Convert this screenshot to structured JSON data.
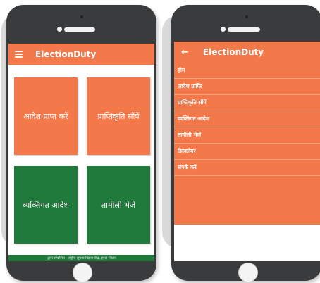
{
  "left_phone": {
    "app_title": "ElectionDuty",
    "tiles": [
      {
        "label": "आदेश प्राप्त करें",
        "color": "#f3784a"
      },
      {
        "label": "प्राप्तिकृति सौंपें",
        "color": "#f3784a"
      },
      {
        "label": "व्यक्तिगत आदेश",
        "color": "#1f7a3c"
      },
      {
        "label": "तामीली भेजें",
        "color": "#1f7a3c"
      }
    ],
    "footer_text": "द्वारा संचालित - राष्ट्रीय सूचना विज्ञान केंद्र, हरदा जिला"
  },
  "right_phone": {
    "app_title": "ElectionDuty",
    "menu_items": [
      {
        "label": "होम"
      },
      {
        "label": "आदेश प्राप्ति"
      },
      {
        "label": "प्राप्तिकृति सौंपें"
      },
      {
        "label": "व्यक्तिगत आदेश"
      },
      {
        "label": "तामीली भेजें"
      },
      {
        "label": "डिस्क्लेमर"
      },
      {
        "label": "संपर्क करें"
      }
    ]
  },
  "colors": {
    "accent_orange": "#f3784a",
    "accent_green": "#1f7a3c",
    "phone_body": "#3a3b3d"
  },
  "icons": [
    "hamburger-icon",
    "back-arrow-icon",
    "home-button-icon"
  ]
}
